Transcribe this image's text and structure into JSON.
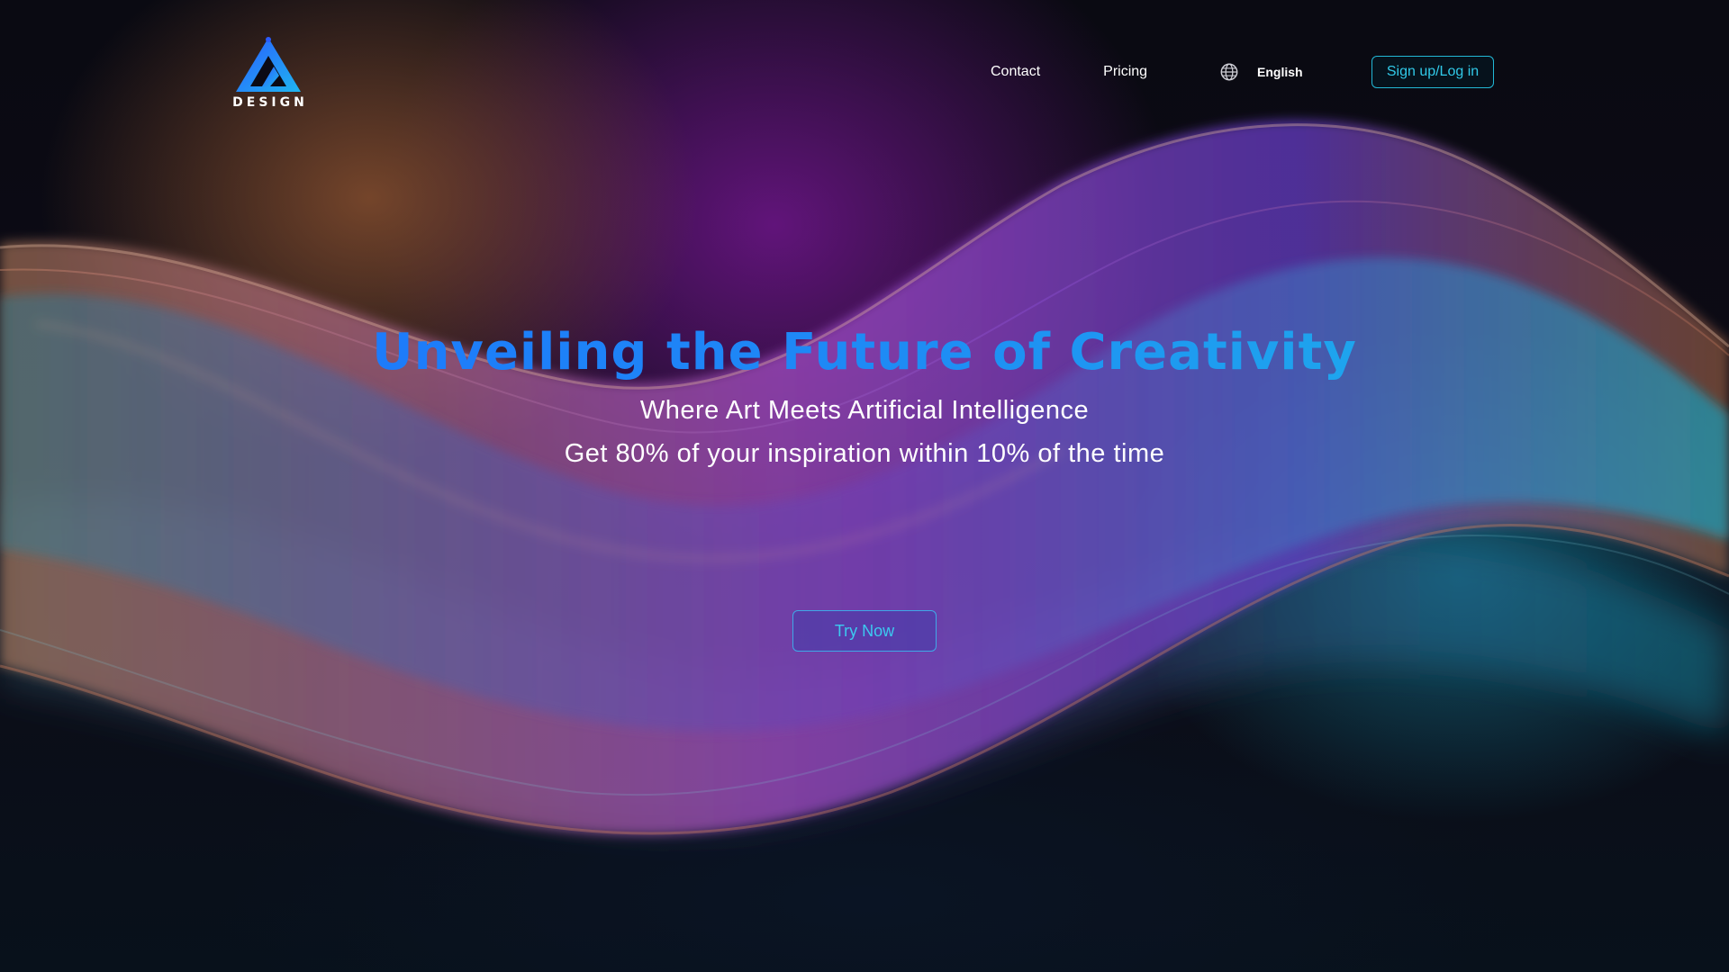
{
  "brand": {
    "logo_text": "DESIGN",
    "logo_icon": "triangle-logo-icon",
    "accent_blue": "#1c70ff",
    "accent_cyan": "#22b8d6"
  },
  "nav": {
    "contact_label": "Contact",
    "pricing_label": "Pricing",
    "language_icon": "globe-icon",
    "language_label": "English",
    "signup_label": "Sign up/Log in"
  },
  "hero": {
    "title": "Unveiling the Future of Creativity",
    "subtitle": "Where Art Meets Artificial Intelligence",
    "tagline": "Get 80% of your inspiration within 10% of the time",
    "cta_label": "Try Now"
  }
}
